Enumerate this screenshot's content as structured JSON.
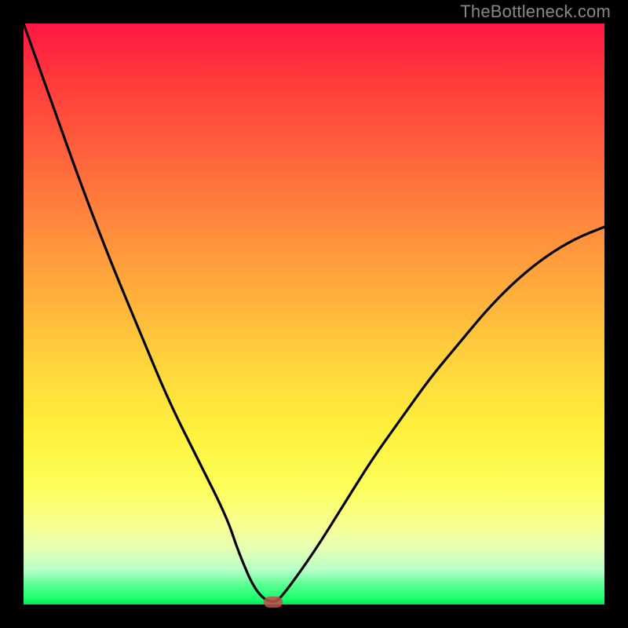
{
  "watermark": "TheBottleneck.com",
  "colors": {
    "background": "#000000",
    "gradient_top": "#ff1744",
    "gradient_bottom": "#00e65a",
    "curve": "#000000",
    "marker": "#c0504d"
  },
  "chart_data": {
    "type": "line",
    "title": "",
    "xlabel": "",
    "ylabel": "",
    "xlim": [
      0,
      100
    ],
    "ylim": [
      0,
      100
    ],
    "x": [
      0,
      5,
      10,
      15,
      20,
      25,
      30,
      35,
      37,
      40,
      43,
      45,
      50,
      55,
      60,
      65,
      70,
      75,
      80,
      85,
      90,
      95,
      100
    ],
    "values": [
      100,
      86,
      72,
      59,
      47,
      35,
      25,
      15,
      9,
      2,
      0,
      2,
      9,
      17,
      25,
      32,
      39,
      45,
      51,
      56,
      60,
      63,
      65
    ],
    "marker": {
      "x": 43,
      "y": 0
    },
    "annotations": []
  }
}
